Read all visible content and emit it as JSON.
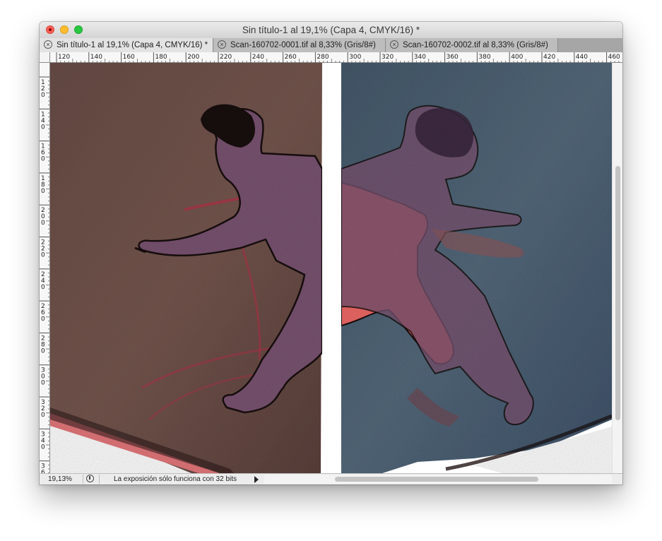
{
  "window": {
    "title": "Sin título-1 al 19,1% (Capa 4, CMYK/16) *"
  },
  "tabs": [
    {
      "label": "Sin título-1 al 19,1% (Capa 4, CMYK/16) *",
      "active": true
    },
    {
      "label": "Scan-160702-0001.tif al 8,33% (Gris/8#)",
      "active": false
    },
    {
      "label": "Scan-160702-0002.tif al 8,33% (Gris/8#)",
      "active": false
    }
  ],
  "rulers": {
    "horizontal_labels": [
      "120",
      "140",
      "160",
      "180",
      "200",
      "220",
      "240",
      "260",
      "280",
      "300",
      "320",
      "340",
      "360",
      "380",
      "400",
      "420",
      "440",
      "460"
    ],
    "vertical_labels": [
      [
        "1",
        "2",
        "0"
      ],
      [
        "1",
        "4",
        "0"
      ],
      [
        "1",
        "6",
        "0"
      ],
      [
        "1",
        "8",
        "0"
      ],
      [
        "2",
        "0",
        "0"
      ],
      [
        "2",
        "2",
        "0"
      ],
      [
        "2",
        "4",
        "0"
      ],
      [
        "2",
        "6",
        "0"
      ],
      [
        "2",
        "8",
        "0"
      ],
      [
        "3",
        "0",
        "0"
      ],
      [
        "3",
        "2",
        "0"
      ],
      [
        "3",
        "4",
        "0"
      ],
      [
        "3",
        "6"
      ]
    ]
  },
  "status": {
    "zoom": "19,13%",
    "message": "La exposición sólo funciona con 32 bits"
  },
  "colors": {
    "left_panel_bg": "#6e514b",
    "right_panel_bg": "#4d6072",
    "figure_purple": "#7b5572",
    "figure_coral": "#ef6a68",
    "outline": "#1a1212"
  },
  "icons": {
    "tab_close": "close-icon",
    "status_share": "share-icon",
    "status_arrow": "play-arrow-icon"
  }
}
